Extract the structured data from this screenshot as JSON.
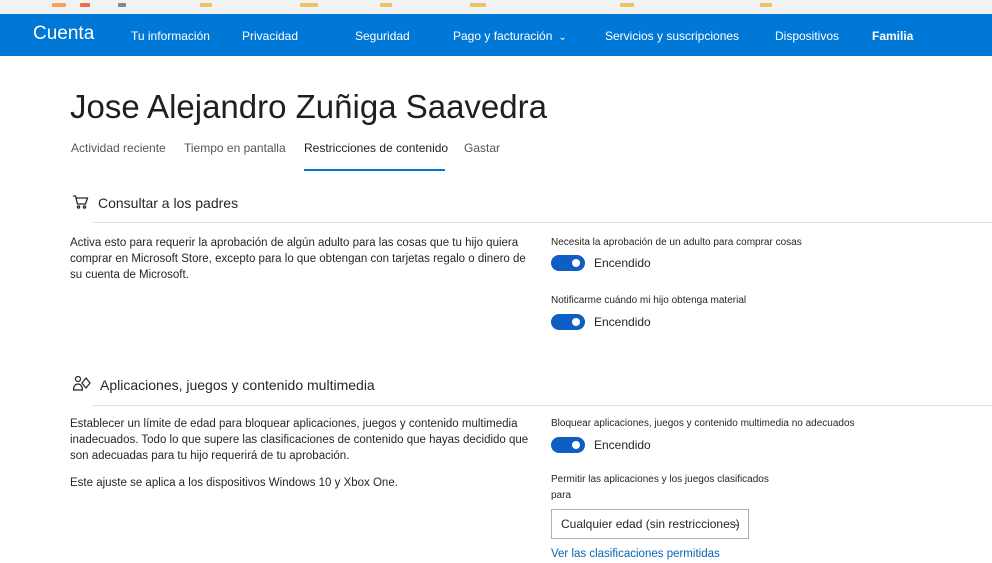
{
  "nav": {
    "brand": "Cuenta",
    "items": [
      {
        "label": "Tu información"
      },
      {
        "label": "Privacidad"
      },
      {
        "label": "Seguridad"
      },
      {
        "label": "Pago y facturación"
      },
      {
        "label": "Servicios y suscripciones"
      },
      {
        "label": "Dispositivos"
      },
      {
        "label": "Familia"
      }
    ],
    "active": "Familia",
    "bg_color": "#0078d7"
  },
  "page": {
    "title": "Jose Alejandro Zuñiga Saavedra",
    "tabs": [
      {
        "label": "Actividad reciente"
      },
      {
        "label": "Tiempo en pantalla"
      },
      {
        "label": "Restricciones de contenido"
      },
      {
        "label": "Gastar"
      }
    ],
    "selected_tab": "Restricciones de contenido"
  },
  "sections": {
    "parents": {
      "title": "Consultar a los padres",
      "description": "Activa esto para requerir la aprobación de algún adulto para las cosas que tu hijo quiera comprar en Microsoft Store, excepto para lo que obtengan con tarjetas regalo o dinero de su cuenta de Microsoft.",
      "settings": [
        {
          "label": "Necesita la aprobación de un adulto para comprar cosas",
          "state": "Encendido",
          "on": true
        },
        {
          "label": "Notificarme cuándo mi hijo obtenga material",
          "state": "Encendido",
          "on": true
        }
      ]
    },
    "apps": {
      "title": "Aplicaciones, juegos y contenido multimedia",
      "description": "Establecer un límite de edad para bloquear aplicaciones, juegos y contenido multimedia inadecuados. Todo lo que supere las clasificaciones de contenido que hayas decidido que son adecuadas para tu hijo requerirá de tu aprobación.",
      "note": "Este ajuste se aplica a los dispositivos Windows 10 y Xbox One.",
      "block_setting": {
        "label": "Bloquear aplicaciones, juegos y contenido multimedia no adecuados",
        "state": "Encendido",
        "on": true
      },
      "rating_label": "Permitir las aplicaciones y los juegos clasificados",
      "rating_label_2": "para",
      "rating_value": "Cualquier edad (sin restricciones)",
      "link": "Ver las clasificaciones permitidas"
    }
  },
  "colors": {
    "accent": "#0078d7",
    "toggle_on": "#0f5ec4",
    "link": "#0067b8"
  }
}
